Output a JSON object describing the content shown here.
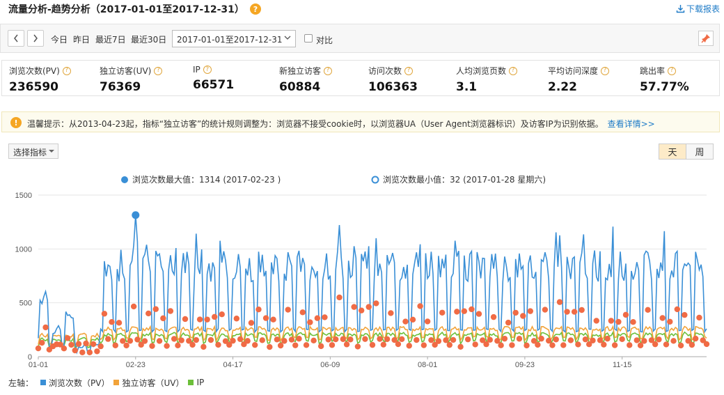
{
  "header": {
    "title": "流量分析-趋势分析（2017-01-01至2017-12-31）",
    "help_icon": "?",
    "download_label": "下载报表"
  },
  "toolbar": {
    "quick_ranges": [
      "今日",
      "昨日",
      "最近7日",
      "最近30日"
    ],
    "date_range": "2017-01-01至2017-12-31",
    "compare_label": "对比"
  },
  "metrics": [
    {
      "label": "浏览次数(PV)",
      "value": "236590",
      "help": true
    },
    {
      "label": "独立访客(UV)",
      "value": "76369",
      "help": true
    },
    {
      "label": "IP",
      "value": "66571",
      "help": true
    },
    {
      "label": "新独立访客",
      "value": "60884",
      "help": true
    },
    {
      "label": "访问次数",
      "value": "106363",
      "help": true
    },
    {
      "label": "人均浏览页数",
      "value": "3.1",
      "help": true
    },
    {
      "label": "平均访问深度",
      "value": "2.22",
      "help": true
    },
    {
      "label": "跳出率",
      "value": "57.77%",
      "help": true
    }
  ],
  "notice": {
    "icon": "!",
    "text": "温馨提示：从2013-04-23起，指标“独立访客”的统计规则调整为：浏览器不接受cookie时，以浏览器UA（User Agent浏览器标识）及访客IP为识别依据。",
    "link": "查看详情>>"
  },
  "controls": {
    "indicator_label": "选择指标",
    "tab_day": "天",
    "tab_week": "周"
  },
  "chart_data": {
    "type": "line",
    "legend_top": [
      {
        "label": "浏览次数最大值：1314 (2017-02-23 )",
        "marker": "filled"
      },
      {
        "label": "浏览次数最小值：32 (2017-01-28 星期六)",
        "marker": "hollow"
      }
    ],
    "yticks": [
      0,
      500,
      1000,
      1500
    ],
    "ylim": [
      0,
      1500
    ],
    "xticks": [
      "01-01",
      "02-23",
      "04-17",
      "06-09",
      "08-01",
      "09-23",
      "11-15"
    ],
    "xtick_day_index": [
      0,
      53,
      106,
      159,
      212,
      265,
      318
    ],
    "days": 365,
    "max_point": {
      "day": 53,
      "value": 1314
    },
    "min_point": {
      "day": 27,
      "value": 32
    },
    "axis_label": "左轴：",
    "series": [
      {
        "name": "浏览次数（PV）",
        "color": "#3a8fd6"
      },
      {
        "name": "独立访客（UV）",
        "color": "#f2a33a"
      },
      {
        "name": "IP",
        "color": "#6cbf3a"
      }
    ],
    "dot_color": "#f06b45"
  },
  "colors": {
    "accent": "#1e7bc7",
    "warning": "#f5a623",
    "tab_active": "#fdebc8"
  }
}
